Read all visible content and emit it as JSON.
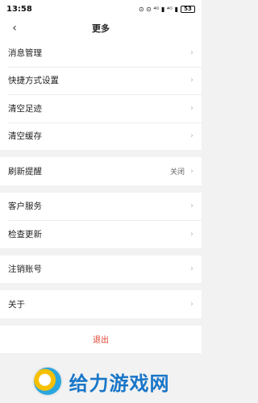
{
  "status": {
    "time": "13:58",
    "icons_text": "⊙ ⊙ ⁴ᴳ ▮ ⁴ᴳ ▮ ",
    "battery": "53"
  },
  "nav": {
    "title": "更多",
    "back_icon": "‹"
  },
  "groups": [
    {
      "items": [
        {
          "label": "消息管理",
          "value": ""
        },
        {
          "label": "快捷方式设置",
          "value": ""
        },
        {
          "label": "清空足迹",
          "value": ""
        },
        {
          "label": "清空缓存",
          "value": ""
        }
      ]
    },
    {
      "items": [
        {
          "label": "刷新提醒",
          "value": "关闭"
        }
      ]
    },
    {
      "items": [
        {
          "label": "客户服务",
          "value": ""
        },
        {
          "label": "检查更新",
          "value": ""
        }
      ]
    },
    {
      "items": [
        {
          "label": "注销账号",
          "value": ""
        }
      ]
    },
    {
      "items": [
        {
          "label": "关于",
          "value": ""
        }
      ]
    }
  ],
  "logout_label": "退出",
  "watermark": {
    "text": "给力游戏网",
    "color": "#1976c8"
  },
  "chevron_glyph": "›"
}
